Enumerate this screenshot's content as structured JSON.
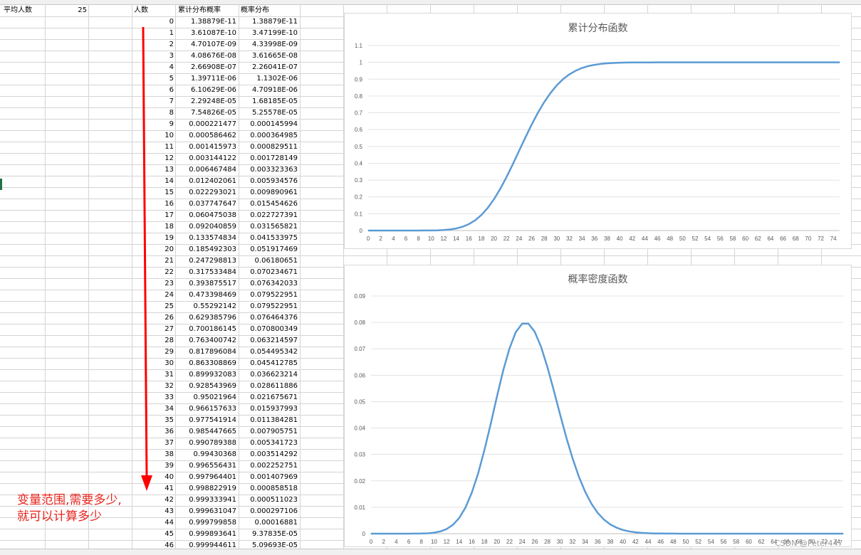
{
  "sheet": {
    "label_avg": "平均人数",
    "avg_value": "25",
    "headers": {
      "people": "人数",
      "cdf": "累计分布概率",
      "pmf": "概率分布"
    },
    "rows": [
      [
        "0",
        "1.38879E-11",
        "1.38879E-11"
      ],
      [
        "1",
        "3.61087E-10",
        "3.47199E-10"
      ],
      [
        "2",
        "4.70107E-09",
        "4.33998E-09"
      ],
      [
        "3",
        "4.08676E-08",
        "3.61665E-08"
      ],
      [
        "4",
        "2.66908E-07",
        "2.26041E-07"
      ],
      [
        "5",
        "1.39711E-06",
        "1.1302E-06"
      ],
      [
        "6",
        "6.10629E-06",
        "4.70918E-06"
      ],
      [
        "7",
        "2.29248E-05",
        "1.68185E-05"
      ],
      [
        "8",
        "7.54826E-05",
        "5.25578E-05"
      ],
      [
        "9",
        "0.000221477",
        "0.000145994"
      ],
      [
        "10",
        "0.000586462",
        "0.000364985"
      ],
      [
        "11",
        "0.001415973",
        "0.000829511"
      ],
      [
        "12",
        "0.003144122",
        "0.001728149"
      ],
      [
        "13",
        "0.006467484",
        "0.003323363"
      ],
      [
        "14",
        "0.012402061",
        "0.005934576"
      ],
      [
        "15",
        "0.022293021",
        "0.009890961"
      ],
      [
        "16",
        "0.037747647",
        "0.015454626"
      ],
      [
        "17",
        "0.060475038",
        "0.022727391"
      ],
      [
        "18",
        "0.092040859",
        "0.031565821"
      ],
      [
        "19",
        "0.133574834",
        "0.041533975"
      ],
      [
        "20",
        "0.185492303",
        "0.051917469"
      ],
      [
        "21",
        "0.247298813",
        "0.06180651"
      ],
      [
        "22",
        "0.317533484",
        "0.070234671"
      ],
      [
        "23",
        "0.393875517",
        "0.076342033"
      ],
      [
        "24",
        "0.473398469",
        "0.079522951"
      ],
      [
        "25",
        "0.55292142",
        "0.079522951"
      ],
      [
        "26",
        "0.629385796",
        "0.076464376"
      ],
      [
        "27",
        "0.700186145",
        "0.070800349"
      ],
      [
        "28",
        "0.763400742",
        "0.063214597"
      ],
      [
        "29",
        "0.817896084",
        "0.054495342"
      ],
      [
        "30",
        "0.863308869",
        "0.045412785"
      ],
      [
        "31",
        "0.899932083",
        "0.036623214"
      ],
      [
        "32",
        "0.928543969",
        "0.028611886"
      ],
      [
        "33",
        "0.95021964",
        "0.021675671"
      ],
      [
        "34",
        "0.966157633",
        "0.015937993"
      ],
      [
        "35",
        "0.977541914",
        "0.011384281"
      ],
      [
        "36",
        "0.985447665",
        "0.007905751"
      ],
      [
        "37",
        "0.990789388",
        "0.005341723"
      ],
      [
        "38",
        "0.99430368",
        "0.003514292"
      ],
      [
        "39",
        "0.996556431",
        "0.002252751"
      ],
      [
        "40",
        "0.997964401",
        "0.001407969"
      ],
      [
        "41",
        "0.998822919",
        "0.000858518"
      ],
      [
        "42",
        "0.999333941",
        "0.000511023"
      ],
      [
        "43",
        "0.999631047",
        "0.000297106"
      ],
      [
        "44",
        "0.999799858",
        "0.00016881"
      ],
      [
        "45",
        "0.999893641",
        "9.37835E-05"
      ],
      [
        "46",
        "0.999944611",
        "5.09693E-05"
      ]
    ]
  },
  "annotation": {
    "line1": "变量范围,需要多少,",
    "line2": "就可以计算多少"
  },
  "watermark": "CSDN @Peter447",
  "colors": {
    "series": "#5b9bd5",
    "arrow": "#ff0000",
    "annotation": "#e8241c",
    "grid": "#d9d9d9"
  },
  "chart_data": [
    {
      "type": "line",
      "title": "累计分布函数",
      "x": [
        0,
        1,
        2,
        3,
        4,
        5,
        6,
        7,
        8,
        9,
        10,
        11,
        12,
        13,
        14,
        15,
        16,
        17,
        18,
        19,
        20,
        21,
        22,
        23,
        24,
        25,
        26,
        27,
        28,
        29,
        30,
        31,
        32,
        33,
        34,
        35,
        36,
        37,
        38,
        39,
        40,
        41,
        42,
        43,
        44,
        45,
        46,
        47,
        48,
        49,
        50,
        51,
        52,
        53,
        54,
        55,
        56,
        57,
        58,
        59,
        60,
        61,
        62,
        63,
        64,
        65,
        66,
        67,
        68,
        69,
        70,
        71,
        72,
        73,
        74,
        75
      ],
      "y": [
        0,
        0,
        0,
        0,
        0,
        1e-06,
        6e-06,
        2.3e-05,
        7.5e-05,
        0.000221,
        0.000586,
        0.001416,
        0.003144,
        0.006467,
        0.012402,
        0.022293,
        0.037748,
        0.060475,
        0.092041,
        0.133575,
        0.185492,
        0.247299,
        0.317533,
        0.393876,
        0.473398,
        0.552921,
        0.629386,
        0.700186,
        0.763401,
        0.817896,
        0.863309,
        0.899932,
        0.928544,
        0.95022,
        0.966158,
        0.977542,
        0.985448,
        0.990789,
        0.994304,
        0.996556,
        0.997964,
        0.998823,
        0.999334,
        0.999631,
        0.9998,
        0.999894,
        0.999945,
        0.999971,
        0.999986,
        0.999993,
        0.999997,
        0.999998,
        0.999999,
        1,
        1,
        1,
        1,
        1,
        1,
        1,
        1,
        1,
        1,
        1,
        1,
        1,
        1,
        1,
        1,
        1,
        1,
        1,
        1,
        1,
        1,
        1
      ],
      "ylim": [
        0,
        1.1
      ],
      "yticks": [
        "0",
        "0.1",
        "0.2",
        "0.3",
        "0.4",
        "0.5",
        "0.6",
        "0.7",
        "0.8",
        "0.9",
        "1",
        "1.1"
      ],
      "xticks": [
        "0",
        "2",
        "4",
        "6",
        "8",
        "10",
        "12",
        "14",
        "16",
        "18",
        "20",
        "22",
        "24",
        "26",
        "28",
        "30",
        "32",
        "34",
        "36",
        "38",
        "40",
        "42",
        "44",
        "46",
        "48",
        "50",
        "52",
        "54",
        "56",
        "58",
        "60",
        "62",
        "64",
        "66",
        "68",
        "70",
        "72",
        "74"
      ],
      "grid": true,
      "color": "#5b9bd5"
    },
    {
      "type": "line",
      "title": "概率密度函数",
      "x": [
        0,
        1,
        2,
        3,
        4,
        5,
        6,
        7,
        8,
        9,
        10,
        11,
        12,
        13,
        14,
        15,
        16,
        17,
        18,
        19,
        20,
        21,
        22,
        23,
        24,
        25,
        26,
        27,
        28,
        29,
        30,
        31,
        32,
        33,
        34,
        35,
        36,
        37,
        38,
        39,
        40,
        41,
        42,
        43,
        44,
        45,
        46,
        47,
        48,
        49,
        50,
        51,
        52,
        53,
        54,
        55,
        56,
        57,
        58,
        59,
        60,
        61,
        62,
        63,
        64,
        65,
        66,
        67,
        68,
        69,
        70,
        71,
        72,
        73,
        74,
        75
      ],
      "y": [
        0,
        0,
        0,
        0,
        0,
        1e-06,
        5e-06,
        1.7e-05,
        5.3e-05,
        0.000146,
        0.000365,
        0.00083,
        0.001728,
        0.003323,
        0.005935,
        0.009891,
        0.015455,
        0.022727,
        0.031566,
        0.041534,
        0.051917,
        0.061807,
        0.070235,
        0.076342,
        0.079523,
        0.079523,
        0.076464,
        0.0708,
        0.063215,
        0.054495,
        0.045413,
        0.036623,
        0.028612,
        0.021676,
        0.015938,
        0.011384,
        0.007906,
        0.005342,
        0.003514,
        0.002253,
        0.001408,
        0.000859,
        0.000511,
        0.000297,
        0.000169,
        9.4e-05,
        5.1e-05,
        2.7e-05,
        1.4e-05,
        7e-06,
        4e-06,
        2e-06,
        1e-06,
        0,
        0,
        0,
        0,
        0,
        0,
        0,
        0,
        0,
        0,
        0,
        0,
        0,
        0,
        0,
        0,
        0,
        0,
        0,
        0,
        0,
        0,
        0
      ],
      "ylim": [
        0,
        0.09
      ],
      "yticks": [
        "0",
        "0.01",
        "0.02",
        "0.03",
        "0.04",
        "0.05",
        "0.06",
        "0.07",
        "0.08",
        "0.09"
      ],
      "xticks": [
        "0",
        "2",
        "4",
        "6",
        "8",
        "10",
        "12",
        "14",
        "16",
        "18",
        "20",
        "22",
        "24",
        "26",
        "28",
        "30",
        "32",
        "34",
        "36",
        "38",
        "40",
        "42",
        "44",
        "46",
        "48",
        "50",
        "52",
        "54",
        "56",
        "58",
        "60",
        "62",
        "64",
        "66",
        "68",
        "70",
        "72",
        "74"
      ],
      "grid": true,
      "color": "#5b9bd5"
    }
  ]
}
